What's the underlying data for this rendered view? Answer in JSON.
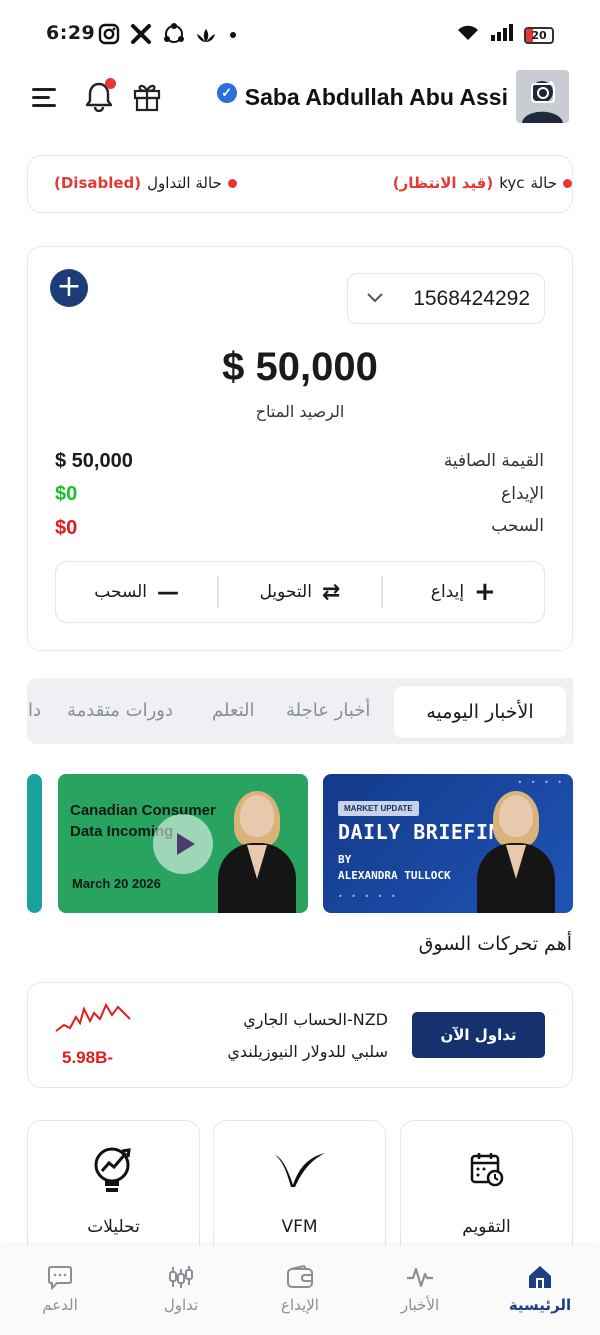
{
  "status_bar": {
    "time": "6:29",
    "battery": "20",
    "icons": [
      "instagram-icon",
      "x-icon",
      "share-icon",
      "lotus-icon",
      "dot"
    ]
  },
  "header": {
    "user_name": "Saba Abdullah Abu Assi",
    "verified_mark": "✓"
  },
  "status": {
    "kyc_label": "حالة",
    "kyc_key": "kyc",
    "kyc_value": "(قيد الانتظار)",
    "trading_label": "حالة التداول",
    "trading_value": "(Disabled)"
  },
  "account": {
    "number": "1568424292",
    "available_balance": "$ 50,000",
    "available_label": "الرصيد المتاح",
    "net_value_label": "القيمة الصافية",
    "net_value": "$ 50,000",
    "deposit_label": "الإيداع",
    "deposit_value": "$0",
    "withdraw_label": "السحب",
    "withdraw_value": "$0",
    "actions": {
      "deposit": "إيداع",
      "transfer": "التحويل",
      "withdraw": "السحب"
    }
  },
  "tabs": {
    "active": "الأخبار اليوميه",
    "items": [
      "أخبار عاجلة",
      "التعلم",
      "دورات متقدمة",
      "دا"
    ]
  },
  "media": {
    "card1_title": "Canadian Consumer Data Incoming",
    "card1_date": "March 20 2026",
    "card2_badge": "MARKET UPDATE",
    "card2_title": "DAILY BRIEFING",
    "card2_by": "BY",
    "card2_author": "ALEXANDRA TULLOCK"
  },
  "market": {
    "section_title": "أهم تحركات السوق",
    "trade_button": "تداول الآن",
    "line1": "NZD-الحساب الجاري",
    "line2": "سلبي للدولار النيوزيلندي",
    "value": "5.98B-",
    "value_color": "#e31b1b"
  },
  "tiles": {
    "analysis": "تحليلات",
    "vfm": "VFM",
    "calendar": "التقويم"
  },
  "bottom_nav": {
    "support": "الدعم",
    "trade": "تداول",
    "deposit": "الإيداع",
    "news": "الأخبار",
    "home": "الرئيسية"
  },
  "colors": {
    "brand_navy": "#15326f",
    "alert_red": "#e53935",
    "positive_green": "#19c02e"
  }
}
